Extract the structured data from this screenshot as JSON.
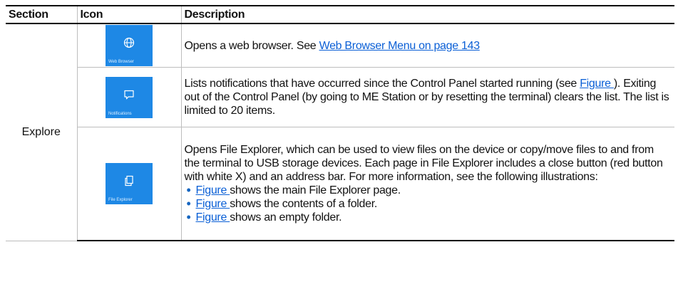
{
  "table": {
    "headers": {
      "section": "Section",
      "icon": "Icon",
      "description": "Description"
    },
    "section_label": "Explore",
    "rows": [
      {
        "tile": {
          "label": "Web Browser",
          "icon": "globe-icon",
          "color": "#1e88e5"
        },
        "desc_text": "Opens a web browser. See ",
        "desc_link": "Web Browser Menu on page 143"
      },
      {
        "tile": {
          "label": "Notifications",
          "icon": "chat-bubble-icon",
          "color": "#1e88e5"
        },
        "desc_pre": "Lists notifications that have occurred since the Control Panel started running (see ",
        "desc_link": "Figure ",
        "desc_post": "). Exiting out of the Control Panel (by going to ME Station or by resetting the terminal) clears the list. The list is limited to 20 items."
      },
      {
        "tile": {
          "label": "File Explorer",
          "icon": "copy-files-icon",
          "color": "#1e88e5"
        },
        "desc_intro": "Opens File Explorer, which can be used to view files on the device or copy/move files to and from the terminal to USB storage devices. Each page in File Explorer includes a close button (red button with white X) and an address bar. For more information, see the following illustrations:",
        "bullets": [
          {
            "link": "Figure ",
            "text": " shows the main File Explorer page."
          },
          {
            "link": "Figure ",
            "text": " shows the contents of a folder."
          },
          {
            "link": "Figure ",
            "text": " shows an empty folder."
          }
        ]
      }
    ]
  }
}
